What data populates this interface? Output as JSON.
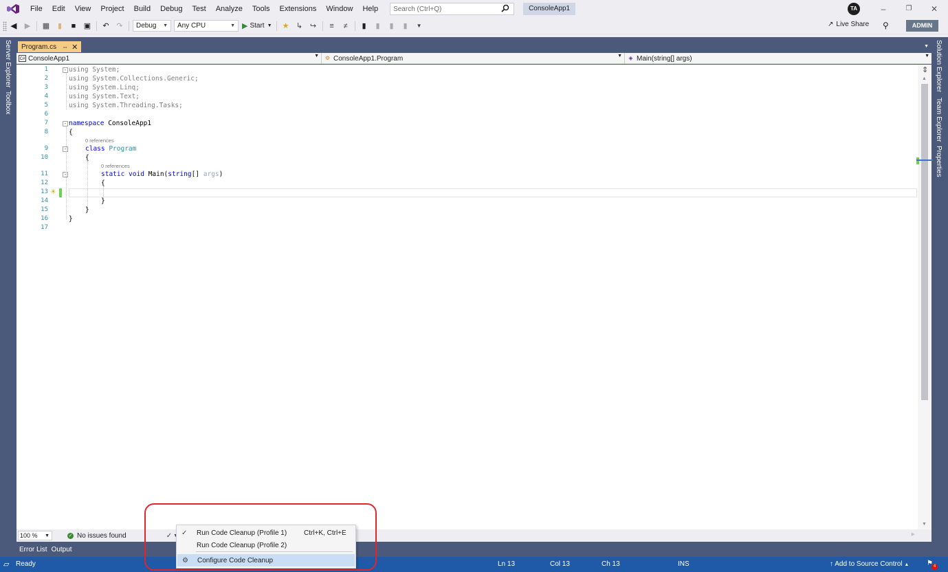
{
  "menu": {
    "items": [
      "File",
      "Edit",
      "View",
      "Project",
      "Build",
      "Debug",
      "Test",
      "Analyze",
      "Tools",
      "Extensions",
      "Window",
      "Help"
    ],
    "search_placeholder": "Search (Ctrl+Q)",
    "solution_name": "ConsoleApp1",
    "user_initials": "TA"
  },
  "toolbar": {
    "config": "Debug",
    "platform": "Any CPU",
    "start_label": "Start",
    "live_share": "Live Share",
    "admin": "ADMIN"
  },
  "left_rail": {
    "tabs": [
      "Server Explorer",
      "Toolbox"
    ]
  },
  "right_rail": {
    "tabs": [
      "Solution Explorer",
      "Team Explorer",
      "Properties"
    ]
  },
  "document": {
    "tab_label": "Program.cs",
    "nav_project": "ConsoleApp1",
    "nav_class": "ConsoleApp1.Program",
    "nav_member": "Main(string[] args)"
  },
  "code": {
    "line_numbers": [
      "1",
      "2",
      "3",
      "4",
      "5",
      "6",
      "7",
      "8",
      "9",
      "10",
      "11",
      "12",
      "13",
      "14",
      "15",
      "16",
      "17"
    ],
    "using1": "using System;",
    "using2": "using System.Collections.Generic;",
    "using3": "using System.Linq;",
    "using4": "using System.Text;",
    "using5": "using System.Threading.Tasks;",
    "ns_kw": "namespace",
    "ns_name": " ConsoleApp1",
    "open_brace": "{",
    "close_brace": "}",
    "class_kw": "class",
    "class_name": " Program",
    "static_kw": "static",
    "void_kw": " void",
    "main_name": " Main(",
    "string_kw": "string",
    "array_part": "[] ",
    "args_name": "args",
    "close_paren": ")",
    "codelens": "0 references"
  },
  "footer": {
    "zoom": "100 %",
    "issues": "No issues found"
  },
  "context_menu": {
    "run_profile1": "Run Code Cleanup (Profile 1)",
    "run_profile1_shortcut": "Ctrl+K, Ctrl+E",
    "run_profile2": "Run Code Cleanup (Profile 2)",
    "configure": "Configure Code Cleanup"
  },
  "tool_tabs": [
    "Error List",
    "Output"
  ],
  "status": {
    "ready": "Ready",
    "line": "Ln 13",
    "col": "Col 13",
    "ch": "Ch 13",
    "mode": "INS",
    "source_control": "Add to Source Control",
    "notifications": "4"
  },
  "colors": {
    "accent": "#1f5aa8",
    "rail": "#4b5a7a",
    "active_tab": "#f5cc84",
    "annotation": "#e0262c"
  }
}
